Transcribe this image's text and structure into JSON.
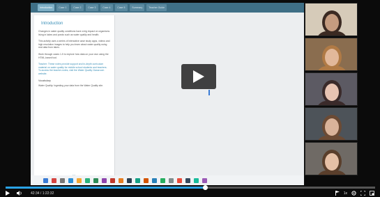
{
  "shared_screen": {
    "tabs": [
      "Introduction",
      "Case 1",
      "Case 2",
      "Case 3",
      "Case 4",
      "Case 5",
      "Summary",
      "Teacher Guide"
    ],
    "panel": {
      "title": "Introduction",
      "paragraphs": [
        "Changes in water quality conditions have a big impact on organisms living in lakes and ponds such as water quality and health.",
        "This activity uses a series of interactive case study apps, videos and high resolution images to help you learn about water quality using real data from lakes.",
        "Work through cases 1-5 to explore how data on your own using the HTML-based tool.",
        "Teacher: These notes provide support and in-depth curriculum material on water quality for middle school students and teachers. To access the teacher-notes, visit the Water Quality Classroom website.",
        "Vocabulary",
        "Water Quality: Ingesting your data from the Water Quality site."
      ],
      "chevron": "⌄"
    },
    "taskbar_colors": [
      "#3a7bd5",
      "#d64541",
      "#777777",
      "#2c8fd6",
      "#f3a733",
      "#2ab27b",
      "#2e8b57",
      "#8e44ad",
      "#c0392b",
      "#e67e22",
      "#2c3e50",
      "#16a085",
      "#d35400",
      "#2980b9",
      "#27ae60",
      "#7f8c8d",
      "#e74c3c",
      "#34495e",
      "#1abc9c",
      "#9b59b6"
    ]
  },
  "player": {
    "play_icon": "play-icon",
    "progress_fraction": 0.54,
    "current_time": "42:34",
    "duration": "1:22:32",
    "speed": "1x"
  },
  "participants": [
    {
      "bg": "#d6cbb9",
      "skin": "#c59c80",
      "hair": "#3b2a22"
    },
    {
      "bg": "#8a6d4f",
      "skin": "#e2b89a",
      "hair": "#b07a45"
    },
    {
      "bg": "#5c5a63",
      "skin": "#e8c4b3",
      "hair": "#3a2a2a"
    },
    {
      "bg": "#4d5359",
      "skin": "#d9b39a",
      "hair": "#6b4a34"
    },
    {
      "bg": "#6f6a65",
      "skin": "#e6c0a6",
      "hair": "#5a3e2b"
    }
  ]
}
